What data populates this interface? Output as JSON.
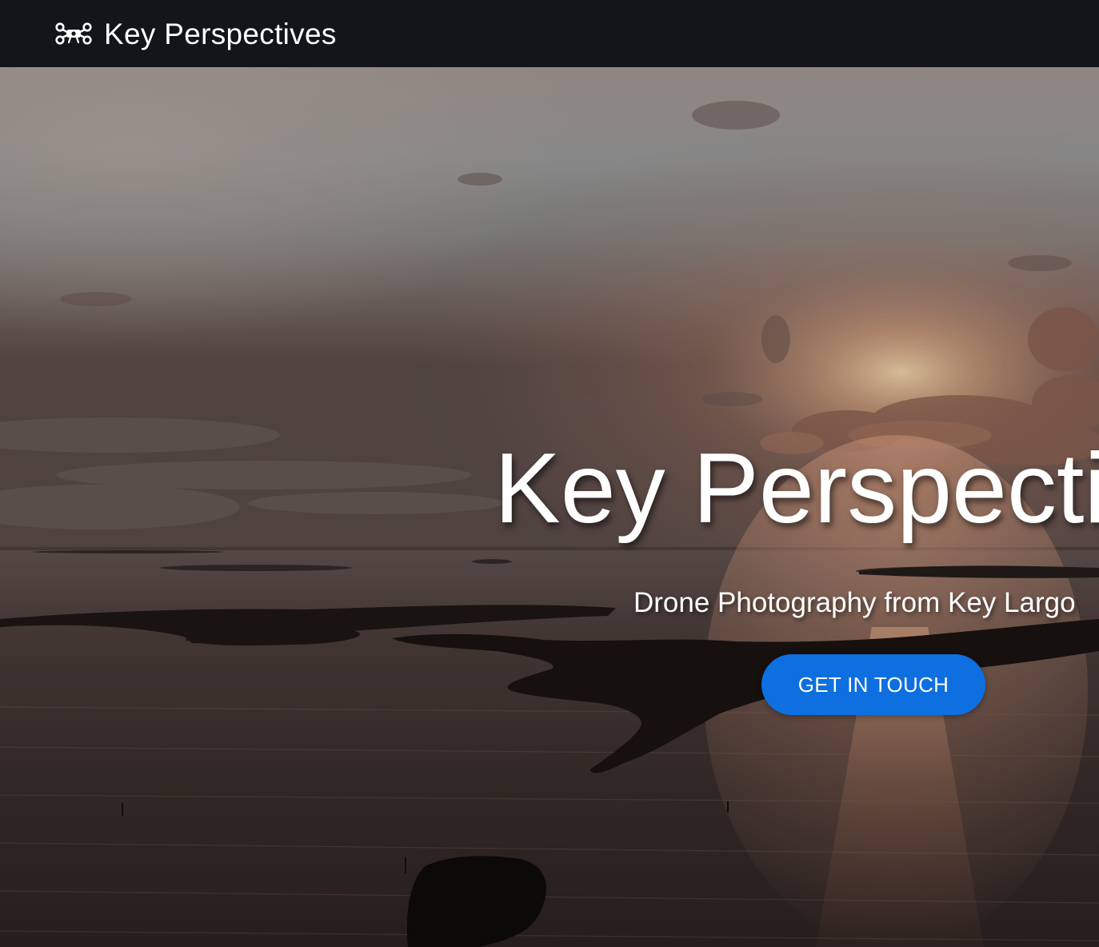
{
  "navbar": {
    "brand_icon": "drone-icon",
    "brand_name": "Key Perspectives"
  },
  "hero": {
    "title": "Key Perspectives",
    "subtitle": "Drone Photography from Key Largo",
    "cta_label": "GET IN TOUCH",
    "background": "aerial-sunset-over-key-largo-islands"
  },
  "colors": {
    "navbar_bg": "#121519",
    "cta_bg": "#0d6fe0",
    "text": "#ffffff"
  }
}
